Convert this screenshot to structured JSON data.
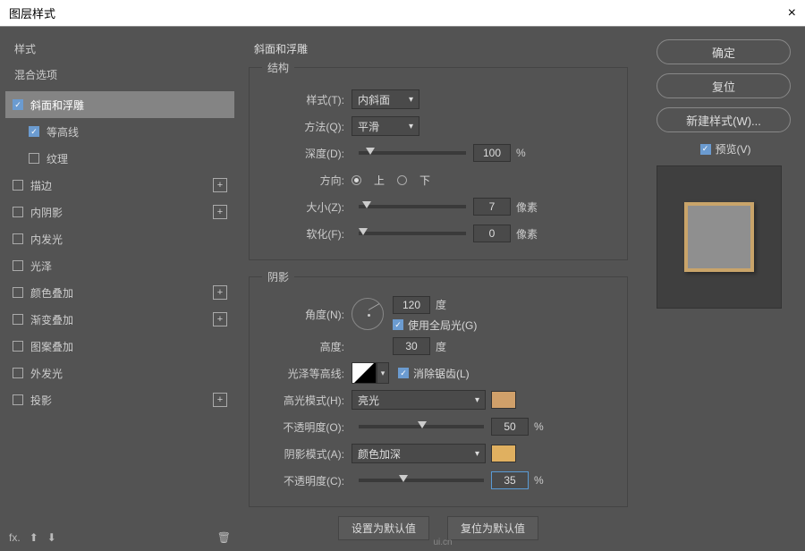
{
  "window": {
    "title": "图层样式",
    "close": "×"
  },
  "sidebar": {
    "styles_label": "样式",
    "blending_label": "混合选项",
    "items": [
      {
        "label": "斜面和浮雕",
        "checked": true,
        "selected": true
      },
      {
        "label": "等高线",
        "checked": true,
        "indent": true
      },
      {
        "label": "纹理",
        "checked": false,
        "indent": true
      },
      {
        "label": "描边",
        "checked": false,
        "plus": true
      },
      {
        "label": "内阴影",
        "checked": false,
        "plus": true
      },
      {
        "label": "内发光",
        "checked": false
      },
      {
        "label": "光泽",
        "checked": false
      },
      {
        "label": "颜色叠加",
        "checked": false,
        "plus": true
      },
      {
        "label": "渐变叠加",
        "checked": false,
        "plus": true
      },
      {
        "label": "图案叠加",
        "checked": false
      },
      {
        "label": "外发光",
        "checked": false
      },
      {
        "label": "投影",
        "checked": false,
        "plus": true
      }
    ],
    "fx": "fx"
  },
  "center": {
    "title": "斜面和浮雕",
    "structure": {
      "legend": "结构",
      "style_label": "样式(T):",
      "style_value": "内斜面",
      "technique_label": "方法(Q):",
      "technique_value": "平滑",
      "depth_label": "深度(D):",
      "depth_value": "100",
      "depth_unit": "%",
      "direction_label": "方向:",
      "up": "上",
      "down": "下",
      "size_label": "大小(Z):",
      "size_value": "7",
      "size_unit": "像素",
      "soften_label": "软化(F):",
      "soften_value": "0",
      "soften_unit": "像素"
    },
    "shading": {
      "legend": "阴影",
      "angle_label": "角度(N):",
      "angle_value": "120",
      "angle_unit": "度",
      "global_light": "使用全局光(G)",
      "altitude_label": "高度:",
      "altitude_value": "30",
      "altitude_unit": "度",
      "gloss_label": "光泽等高线:",
      "antialias": "消除锯齿(L)",
      "highlight_mode_label": "高光模式(H):",
      "highlight_mode_value": "亮光",
      "highlight_opacity_label": "不透明度(O):",
      "highlight_opacity_value": "50",
      "opacity_unit": "%",
      "shadow_mode_label": "阴影模式(A):",
      "shadow_mode_value": "颜色加深",
      "shadow_opacity_label": "不透明度(C):",
      "shadow_opacity_value": "35",
      "highlight_color": "#d0a06a",
      "shadow_color": "#e0b060"
    },
    "buttons": {
      "default": "设置为默认值",
      "reset": "复位为默认值"
    }
  },
  "right": {
    "ok": "确定",
    "cancel": "复位",
    "new_style": "新建样式(W)...",
    "preview_label": "预览(V)"
  },
  "watermark": "ui.cn"
}
